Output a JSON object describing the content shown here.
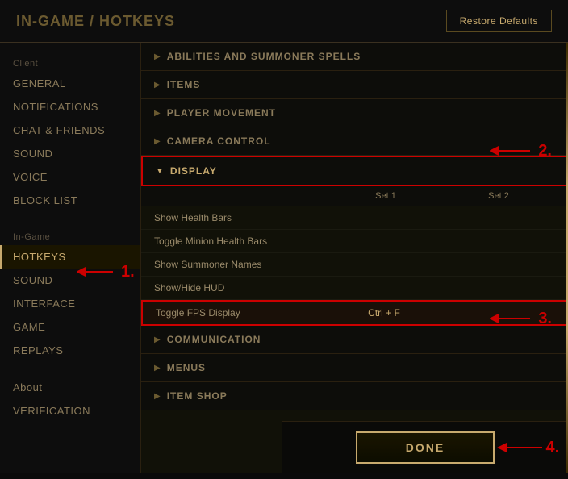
{
  "header": {
    "breadcrumb_prefix": "IN-GAME / ",
    "title": "HOTKEYS",
    "restore_button": "Restore Defaults"
  },
  "sidebar": {
    "client_label": "Client",
    "client_items": [
      {
        "id": "general",
        "label": "GENERAL",
        "active": false
      },
      {
        "id": "notifications",
        "label": "NOTIFICATIONS",
        "active": false
      },
      {
        "id": "chat-friends",
        "label": "CHAT & FRIENDS",
        "active": false
      },
      {
        "id": "sound",
        "label": "SOUND",
        "active": false
      },
      {
        "id": "voice",
        "label": "VOICE",
        "active": false
      },
      {
        "id": "block-list",
        "label": "BLOCK LIST",
        "active": false
      }
    ],
    "ingame_label": "In-Game",
    "ingame_items": [
      {
        "id": "hotkeys",
        "label": "HOTKEYS",
        "active": true
      },
      {
        "id": "sound-ingame",
        "label": "SOUND",
        "active": false
      },
      {
        "id": "interface",
        "label": "INTERFACE",
        "active": false
      },
      {
        "id": "game",
        "label": "GAME",
        "active": false
      },
      {
        "id": "replays",
        "label": "REPLAYS",
        "active": false
      }
    ],
    "about_label": "About",
    "about_items": [
      {
        "id": "verification",
        "label": "VERIFICATION",
        "active": false
      }
    ]
  },
  "main": {
    "set1_label": "Set 1",
    "set2_label": "Set 2",
    "collapsed_sections": [
      {
        "id": "abilities",
        "label": "ABILITIES AND SUMMONER SPELLS",
        "expanded": false
      },
      {
        "id": "items",
        "label": "ITEMS",
        "expanded": false
      },
      {
        "id": "player-movement",
        "label": "PLAYER MOVEMENT",
        "expanded": false
      },
      {
        "id": "camera-control",
        "label": "CAMERA CONTROL",
        "expanded": false
      }
    ],
    "display_section": {
      "label": "DISPLAY",
      "expanded": true,
      "hotkeys": [
        {
          "id": "show-health-bars",
          "name": "Show Health Bars",
          "set1": "",
          "set2": ""
        },
        {
          "id": "toggle-minion-health",
          "name": "Toggle Minion Health Bars",
          "set1": "",
          "set2": ""
        },
        {
          "id": "show-summoner-names",
          "name": "Show Summoner Names",
          "set1": "",
          "set2": ""
        },
        {
          "id": "show-hide-hud",
          "name": "Show/Hide HUD",
          "set1": "",
          "set2": ""
        },
        {
          "id": "toggle-fps",
          "name": "Toggle FPS Display",
          "set1": "Ctrl + F",
          "set2": "",
          "highlighted": true
        }
      ]
    },
    "after_sections": [
      {
        "id": "communication",
        "label": "COMMUNICATION",
        "expanded": false
      },
      {
        "id": "menus",
        "label": "MENUS",
        "expanded": false
      },
      {
        "id": "item-shop",
        "label": "ITEM SHOP",
        "expanded": false
      }
    ]
  },
  "footer": {
    "done_label": "DONE"
  },
  "annotations": [
    {
      "id": "1",
      "label": "1."
    },
    {
      "id": "2",
      "label": "2."
    },
    {
      "id": "3",
      "label": "3."
    },
    {
      "id": "4",
      "label": "4."
    }
  ]
}
